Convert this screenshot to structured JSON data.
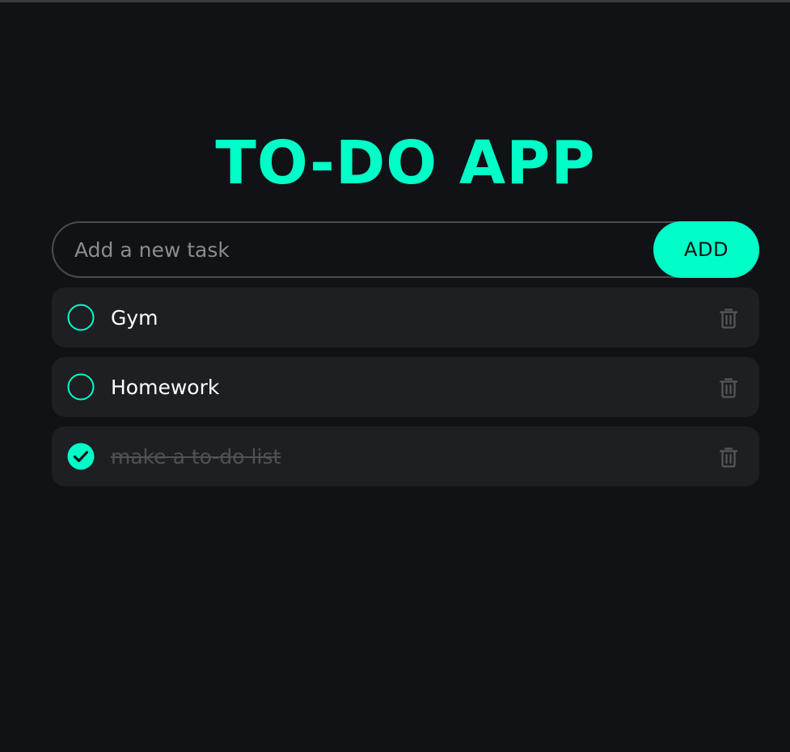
{
  "app": {
    "title": "TO-DO APP"
  },
  "new_task": {
    "value": "",
    "placeholder": "Add a new task",
    "add_label": "ADD"
  },
  "tasks": [
    {
      "text": "Gym",
      "completed": false,
      "check_icon": "circle-outline-icon",
      "delete_icon": "trash-icon"
    },
    {
      "text": "Homework",
      "completed": false,
      "check_icon": "circle-outline-icon",
      "delete_icon": "trash-icon"
    },
    {
      "text": "make a to-do list",
      "completed": true,
      "check_icon": "check-circle-icon",
      "delete_icon": "trash-icon"
    }
  ],
  "colors": {
    "accent": "#00ffc8",
    "background": "#101216",
    "card": "#1d1f23",
    "muted_text": "#4e5257",
    "icon": "#55585d"
  }
}
